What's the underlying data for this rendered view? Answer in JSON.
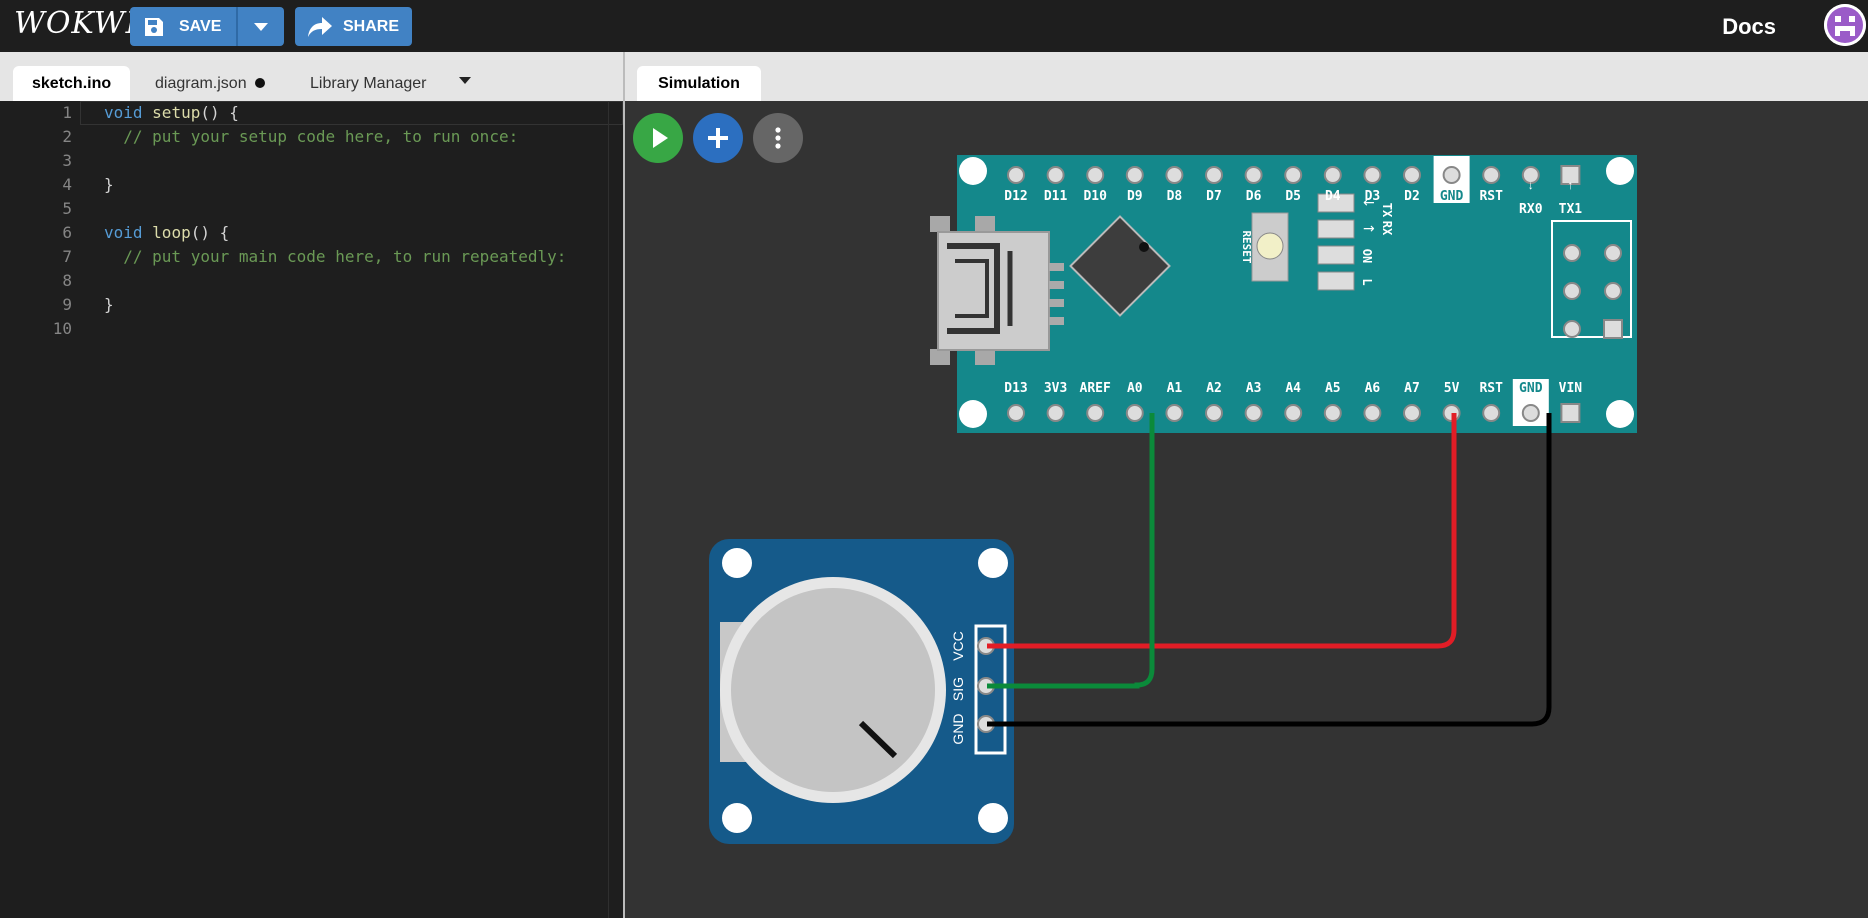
{
  "header": {
    "logo": "WOKWI",
    "save_label": "SAVE",
    "share_label": "SHARE",
    "docs_label": "Docs"
  },
  "editor": {
    "tabs": [
      {
        "label": "sketch.ino",
        "active": true
      },
      {
        "label": "diagram.json",
        "modified": true
      },
      {
        "label": "Library Manager"
      }
    ],
    "line_numbers": [
      "1",
      "2",
      "3",
      "4",
      "5",
      "6",
      "7",
      "8",
      "9",
      "10"
    ],
    "code": {
      "l1_kw": "void",
      "l1_fn": "setup",
      "l1_rest": "() {",
      "l2": "  // put your setup code here, to run once:",
      "l4": "}",
      "l6_kw": "void",
      "l6_fn": "loop",
      "l6_rest": "() {",
      "l7": "  // put your main code here, to run repeatedly:",
      "l9": "}"
    }
  },
  "simulation": {
    "tab_label": "Simulation",
    "board": {
      "top_pins": [
        "D12",
        "D11",
        "D10",
        "D9",
        "D8",
        "D7",
        "D6",
        "D5",
        "D4",
        "D3",
        "D2",
        "GND",
        "RST",
        "RX0",
        "TX1"
      ],
      "bottom_pins": [
        "D13",
        "3V3",
        "AREF",
        "A0",
        "A1",
        "A2",
        "A3",
        "A4",
        "A5",
        "A6",
        "A7",
        "5V",
        "RST",
        "GND",
        "VIN"
      ],
      "reset_label": "RESET",
      "led_labels": [
        "TX",
        "RX",
        "ON",
        "L"
      ]
    },
    "potentiometer": {
      "pins": [
        "VCC",
        "SIG",
        "GND"
      ]
    },
    "colors": {
      "board": "#14888b",
      "pot_board": "#155a8a",
      "wire_vcc": "#e21d26",
      "wire_sig": "#0b8a3a",
      "wire_gnd": "#000000",
      "run_button": "#38a745",
      "add_button": "#2c6fc0",
      "menu_button": "#666666"
    }
  }
}
